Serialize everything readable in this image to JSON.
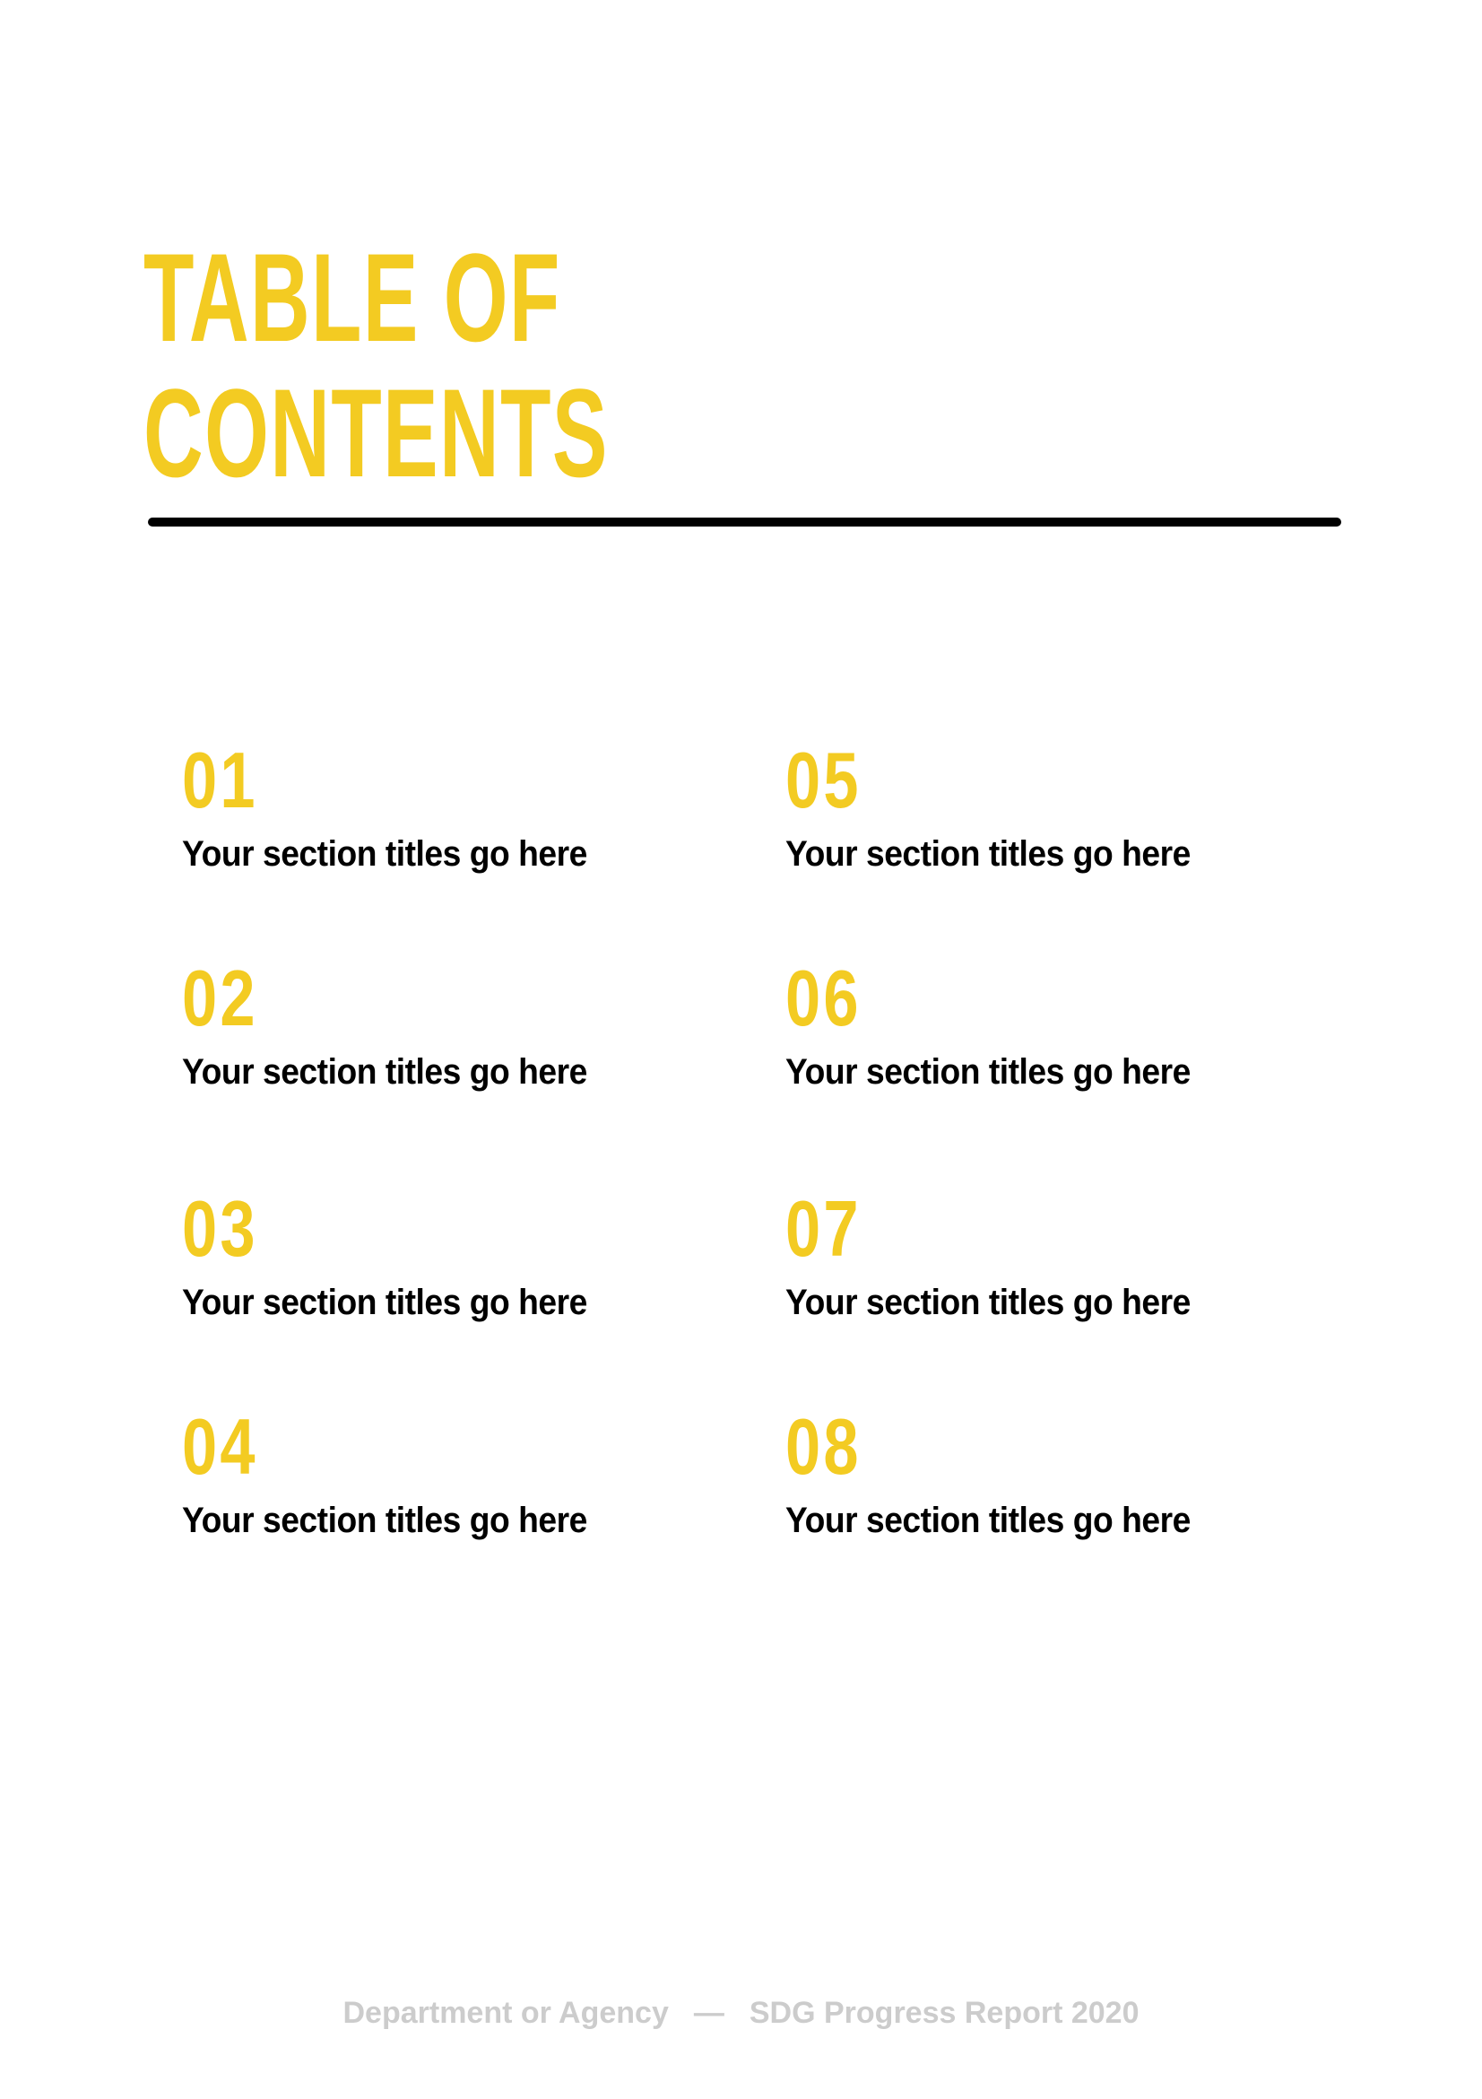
{
  "title": {
    "line1": "TABLE OF",
    "line2": "CONTENTS"
  },
  "colors": {
    "accent": "#f3cb22",
    "text": "#000000",
    "footer": "#cccccc"
  },
  "entries": [
    {
      "number": "01",
      "label": "Your section titles go here"
    },
    {
      "number": "02",
      "label": "Your section titles go here"
    },
    {
      "number": "03",
      "label": "Your section titles go here"
    },
    {
      "number": "04",
      "label": "Your section titles go here"
    },
    {
      "number": "05",
      "label": "Your section titles go here"
    },
    {
      "number": "06",
      "label": "Your section titles go here"
    },
    {
      "number": "07",
      "label": "Your section titles go here"
    },
    {
      "number": "08",
      "label": "Your section titles go here"
    }
  ],
  "footer": {
    "left": "Department or Agency",
    "separator": "—",
    "right": "SDG Progress Report 2020"
  }
}
